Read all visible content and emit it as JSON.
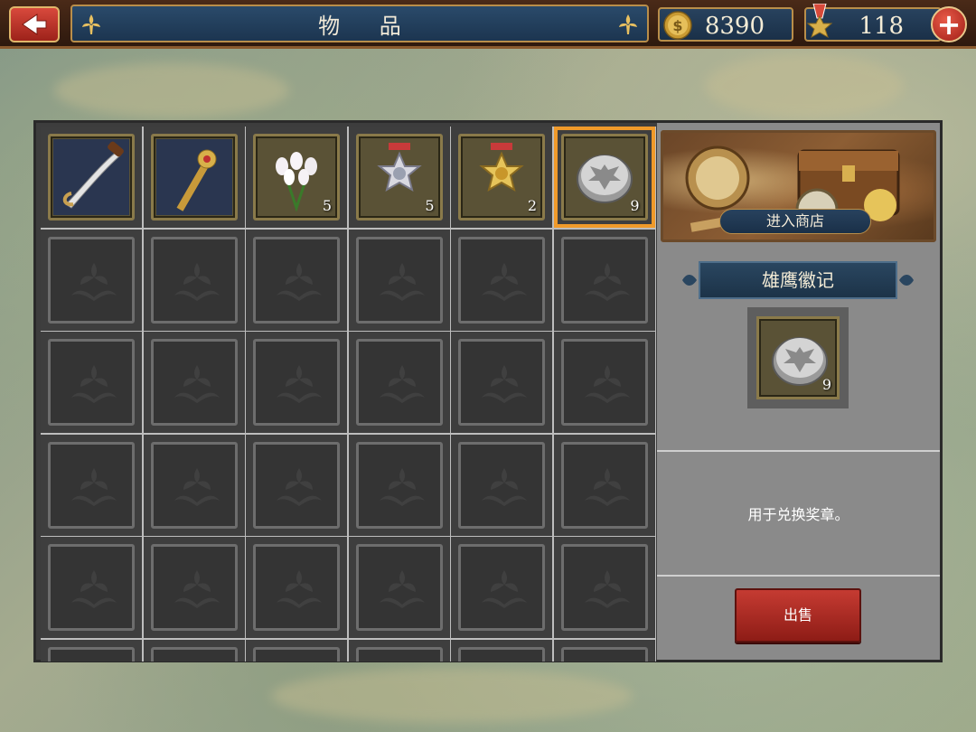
{
  "header": {
    "back_icon": "back-arrow-icon",
    "title": "物 品",
    "gold": {
      "icon": "gold-coin-icon",
      "value": "8390"
    },
    "medals": {
      "icon": "medal-icon",
      "value": "118"
    },
    "add_label": "+"
  },
  "inventory": {
    "items": [
      {
        "name": "saber",
        "icon": "saber-icon",
        "count": ""
      },
      {
        "name": "scepter",
        "icon": "scepter-icon",
        "count": ""
      },
      {
        "name": "tulips",
        "icon": "tulip-bouquet-icon",
        "count": "5"
      },
      {
        "name": "silver-medal",
        "icon": "silver-medal-icon",
        "count": "5"
      },
      {
        "name": "gold-medal",
        "icon": "gold-medal-icon",
        "count": "2"
      },
      {
        "name": "eagle-badge",
        "icon": "eagle-badge-icon",
        "count": "9",
        "selected": true
      }
    ],
    "columns": 6
  },
  "side": {
    "shop_label": "进入商店",
    "item_name": "雄鹰徽记",
    "item_count": "9",
    "description": "用于兑换奖章。",
    "sell_label": "出售"
  },
  "colors": {
    "selection": "#f09a2a",
    "sell_button": "#c53b32",
    "title_bar": "#1c3550"
  }
}
